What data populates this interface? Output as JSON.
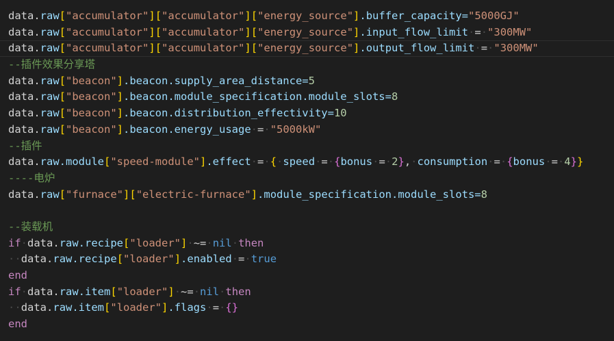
{
  "editor": {
    "lines": [
      {
        "tokens": [
          [
            "data.",
            "id"
          ],
          [
            "raw",
            "prop"
          ],
          [
            "[",
            "br"
          ],
          [
            "\"accumulator\"",
            "str"
          ],
          [
            "]",
            "br"
          ],
          [
            "[",
            "br"
          ],
          [
            "\"accumulator\"",
            "str"
          ],
          [
            "]",
            "br"
          ],
          [
            "[",
            "br"
          ],
          [
            "\"energy_source\"",
            "str"
          ],
          [
            "]",
            "br"
          ],
          [
            ".buffer_capacity=",
            "prop"
          ],
          [
            "\"5000GJ\"",
            "str"
          ]
        ]
      },
      {
        "tokens": [
          [
            "data.",
            "id"
          ],
          [
            "raw",
            "prop"
          ],
          [
            "[",
            "br"
          ],
          [
            "\"accumulator\"",
            "str"
          ],
          [
            "]",
            "br"
          ],
          [
            "[",
            "br"
          ],
          [
            "\"accumulator\"",
            "str"
          ],
          [
            "]",
            "br"
          ],
          [
            "[",
            "br"
          ],
          [
            "\"energy_source\"",
            "str"
          ],
          [
            "]",
            "br"
          ],
          [
            ".input_flow_limit",
            "prop"
          ],
          [
            "·",
            "ws"
          ],
          [
            "=",
            "op"
          ],
          [
            "·",
            "ws"
          ],
          [
            "\"300MW\"",
            "str"
          ]
        ]
      },
      {
        "current": true,
        "tokens": [
          [
            "data.",
            "id"
          ],
          [
            "raw",
            "prop"
          ],
          [
            "[",
            "br"
          ],
          [
            "\"accumulator\"",
            "str"
          ],
          [
            "]",
            "br"
          ],
          [
            "[",
            "br"
          ],
          [
            "\"accumulator\"",
            "str"
          ],
          [
            "]",
            "br"
          ],
          [
            "[",
            "br"
          ],
          [
            "\"energy_source\"",
            "str"
          ],
          [
            "]",
            "br"
          ],
          [
            ".output_flow_limit",
            "prop"
          ],
          [
            "·",
            "ws"
          ],
          [
            "=",
            "op"
          ],
          [
            "·",
            "ws"
          ],
          [
            "\"300MW\"",
            "str"
          ]
        ]
      },
      {
        "tokens": [
          [
            "--插件效果分享塔",
            "cmt"
          ]
        ]
      },
      {
        "tokens": [
          [
            "data.",
            "id"
          ],
          [
            "raw",
            "prop"
          ],
          [
            "[",
            "br"
          ],
          [
            "\"beacon\"",
            "str"
          ],
          [
            "]",
            "br"
          ],
          [
            ".beacon.supply_area_distance=",
            "prop"
          ],
          [
            "5",
            "num"
          ]
        ]
      },
      {
        "tokens": [
          [
            "data.",
            "id"
          ],
          [
            "raw",
            "prop"
          ],
          [
            "[",
            "br"
          ],
          [
            "\"beacon\"",
            "str"
          ],
          [
            "]",
            "br"
          ],
          [
            ".beacon.module_specification.module_slots=",
            "prop"
          ],
          [
            "8",
            "num"
          ]
        ]
      },
      {
        "tokens": [
          [
            "data.",
            "id"
          ],
          [
            "raw",
            "prop"
          ],
          [
            "[",
            "br"
          ],
          [
            "\"beacon\"",
            "str"
          ],
          [
            "]",
            "br"
          ],
          [
            ".beacon.distribution_effectivity=",
            "prop"
          ],
          [
            "10",
            "num"
          ]
        ]
      },
      {
        "tokens": [
          [
            "data.",
            "id"
          ],
          [
            "raw",
            "prop"
          ],
          [
            "[",
            "br"
          ],
          [
            "\"beacon\"",
            "str"
          ],
          [
            "]",
            "br"
          ],
          [
            ".beacon.energy_usage",
            "prop"
          ],
          [
            "·",
            "ws"
          ],
          [
            "=",
            "op"
          ],
          [
            "·",
            "ws"
          ],
          [
            "\"5000kW\"",
            "str"
          ]
        ]
      },
      {
        "tokens": [
          [
            "--插件",
            "cmt"
          ]
        ]
      },
      {
        "tokens": [
          [
            "data.",
            "id"
          ],
          [
            "raw.module",
            "prop"
          ],
          [
            "[",
            "br"
          ],
          [
            "\"speed-module\"",
            "str"
          ],
          [
            "]",
            "br"
          ],
          [
            ".effect",
            "prop"
          ],
          [
            "·",
            "ws"
          ],
          [
            "=",
            "op"
          ],
          [
            "·",
            "ws"
          ],
          [
            "{",
            "br"
          ],
          [
            "·",
            "ws"
          ],
          [
            "speed",
            "prop"
          ],
          [
            "·",
            "ws"
          ],
          [
            "=",
            "op"
          ],
          [
            "·",
            "ws"
          ],
          [
            "{",
            "br2"
          ],
          [
            "bonus",
            "prop"
          ],
          [
            "·",
            "ws"
          ],
          [
            "=",
            "op"
          ],
          [
            "·",
            "ws"
          ],
          [
            "2",
            "num"
          ],
          [
            "}",
            "br2"
          ],
          [
            ",",
            "op"
          ],
          [
            "·",
            "ws"
          ],
          [
            "consumption",
            "prop"
          ],
          [
            "·",
            "ws"
          ],
          [
            "=",
            "op"
          ],
          [
            "·",
            "ws"
          ],
          [
            "{",
            "br2"
          ],
          [
            "bonus",
            "prop"
          ],
          [
            "·",
            "ws"
          ],
          [
            "=",
            "op"
          ],
          [
            "·",
            "ws"
          ],
          [
            "4",
            "num"
          ],
          [
            "}",
            "br2"
          ],
          [
            "}",
            "br"
          ]
        ]
      },
      {
        "tokens": [
          [
            "----电炉",
            "cmt"
          ]
        ]
      },
      {
        "tokens": [
          [
            "data.",
            "id"
          ],
          [
            "raw",
            "prop"
          ],
          [
            "[",
            "br"
          ],
          [
            "\"furnace\"",
            "str"
          ],
          [
            "]",
            "br"
          ],
          [
            "[",
            "br"
          ],
          [
            "\"electric-furnace\"",
            "str"
          ],
          [
            "]",
            "br"
          ],
          [
            ".module_specification.module_slots=",
            "prop"
          ],
          [
            "8",
            "num"
          ]
        ]
      },
      {
        "tokens": []
      },
      {
        "tokens": [
          [
            "--装载机",
            "cmt"
          ]
        ]
      },
      {
        "tokens": [
          [
            "if",
            "ctl"
          ],
          [
            "·",
            "ws"
          ],
          [
            "data.",
            "id"
          ],
          [
            "raw.recipe",
            "prop"
          ],
          [
            "[",
            "br"
          ],
          [
            "\"loader\"",
            "str"
          ],
          [
            "]",
            "br"
          ],
          [
            "·",
            "ws"
          ],
          [
            "~=",
            "op"
          ],
          [
            "·",
            "ws"
          ],
          [
            "nil",
            "kw"
          ],
          [
            "·",
            "ws"
          ],
          [
            "then",
            "ctl"
          ]
        ]
      },
      {
        "tokens": [
          [
            "·",
            "ws"
          ],
          [
            "·",
            "ws"
          ],
          [
            "data.",
            "id"
          ],
          [
            "raw.recipe",
            "prop"
          ],
          [
            "[",
            "br"
          ],
          [
            "\"loader\"",
            "str"
          ],
          [
            "]",
            "br"
          ],
          [
            ".enabled",
            "prop"
          ],
          [
            "·",
            "ws"
          ],
          [
            "=",
            "op"
          ],
          [
            "·",
            "ws"
          ],
          [
            "true",
            "kw"
          ]
        ]
      },
      {
        "tokens": [
          [
            "end",
            "ctl"
          ]
        ]
      },
      {
        "tokens": [
          [
            "if",
            "ctl"
          ],
          [
            "·",
            "ws"
          ],
          [
            "data.",
            "id"
          ],
          [
            "raw.item",
            "prop"
          ],
          [
            "[",
            "br"
          ],
          [
            "\"loader\"",
            "str"
          ],
          [
            "]",
            "br"
          ],
          [
            "·",
            "ws"
          ],
          [
            "~=",
            "op"
          ],
          [
            "·",
            "ws"
          ],
          [
            "nil",
            "kw"
          ],
          [
            "·",
            "ws"
          ],
          [
            "then",
            "ctl"
          ]
        ]
      },
      {
        "tokens": [
          [
            "·",
            "ws"
          ],
          [
            "·",
            "ws"
          ],
          [
            "data.",
            "id"
          ],
          [
            "raw.item",
            "prop"
          ],
          [
            "[",
            "br"
          ],
          [
            "\"loader\"",
            "str"
          ],
          [
            "]",
            "br"
          ],
          [
            ".flags",
            "prop"
          ],
          [
            "·",
            "ws"
          ],
          [
            "=",
            "op"
          ],
          [
            "·",
            "ws"
          ],
          [
            "{}",
            "br2"
          ]
        ]
      },
      {
        "tokens": [
          [
            "end",
            "ctl"
          ]
        ]
      }
    ]
  }
}
